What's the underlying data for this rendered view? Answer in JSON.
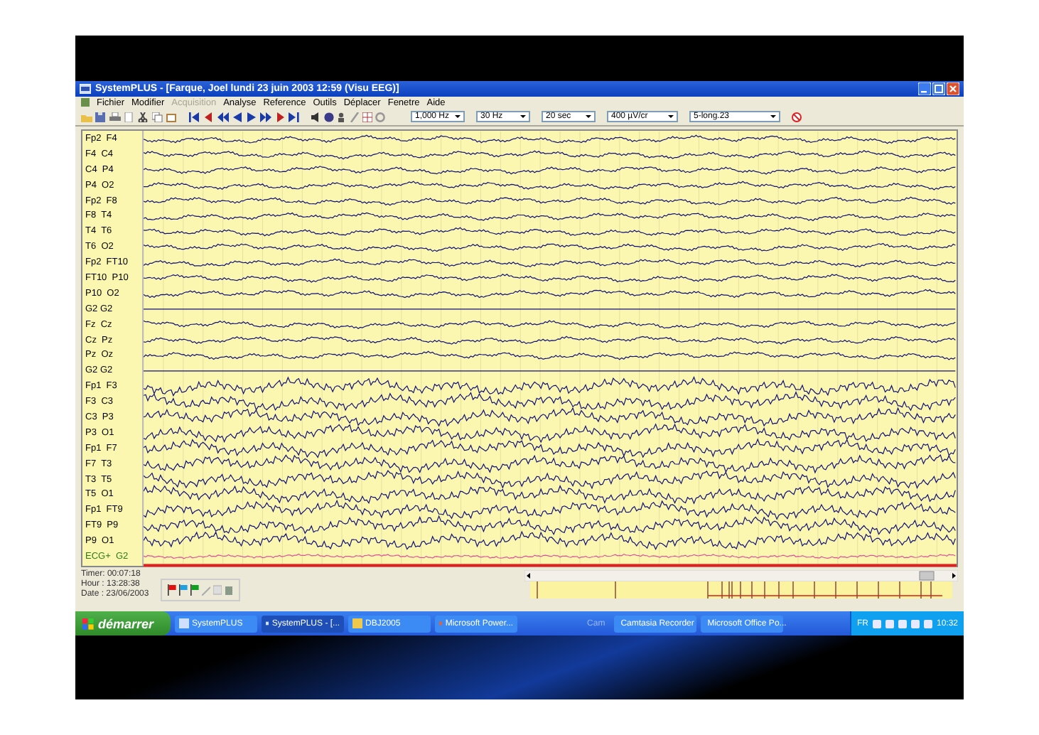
{
  "window": {
    "title": "SystemPLUS - [Farque, Joel lundi 23 juin 2003 12:59 (Visu EEG)]"
  },
  "menu": [
    {
      "label": "Fichier",
      "disabled": false
    },
    {
      "label": "Modifier",
      "disabled": false
    },
    {
      "label": "Acquisition",
      "disabled": true
    },
    {
      "label": "Analyse",
      "disabled": false
    },
    {
      "label": "Reference",
      "disabled": false
    },
    {
      "label": "Outils",
      "disabled": false
    },
    {
      "label": "Déplacer",
      "disabled": false
    },
    {
      "label": "Fenetre",
      "disabled": false
    },
    {
      "label": "Aide",
      "disabled": false
    }
  ],
  "toolbar": {
    "dropdowns": [
      "1,000 Hz",
      "30 Hz",
      "20 sec",
      "400 µV/cr",
      "5-long.23"
    ]
  },
  "channels": [
    {
      "label": "Fp2  F4",
      "kind": "eeg"
    },
    {
      "label": "F4  C4",
      "kind": "eeg"
    },
    {
      "label": "C4  P4",
      "kind": "eeg"
    },
    {
      "label": "P4  O2",
      "kind": "eeg"
    },
    {
      "label": "Fp2  F8",
      "kind": "eeg"
    },
    {
      "label": "F8  T4",
      "kind": "eeg"
    },
    {
      "label": "T4  T6",
      "kind": "eeg"
    },
    {
      "label": "T6  O2",
      "kind": "eeg"
    },
    {
      "label": "Fp2  FT10",
      "kind": "eeg"
    },
    {
      "label": "FT10  P10",
      "kind": "eeg"
    },
    {
      "label": "P10  O2",
      "kind": "eeg"
    },
    {
      "label": "G2 G2",
      "kind": "eeg"
    },
    {
      "label": "Fz  Cz",
      "kind": "eeg"
    },
    {
      "label": "Cz  Pz",
      "kind": "eeg"
    },
    {
      "label": "Pz  Oz",
      "kind": "eeg"
    },
    {
      "label": "G2 G2",
      "kind": "eeg"
    },
    {
      "label": "Fp1  F3",
      "kind": "eeg"
    },
    {
      "label": "F3  C3",
      "kind": "eeg"
    },
    {
      "label": "C3  P3",
      "kind": "eeg"
    },
    {
      "label": "P3  O1",
      "kind": "eeg"
    },
    {
      "label": "Fp1  F7",
      "kind": "eeg"
    },
    {
      "label": "F7  T3",
      "kind": "eeg"
    },
    {
      "label": "T3  T5",
      "kind": "eeg"
    },
    {
      "label": "T5  O1",
      "kind": "eeg"
    },
    {
      "label": "Fp1  FT9",
      "kind": "eeg"
    },
    {
      "label": "FT9  P9",
      "kind": "eeg"
    },
    {
      "label": "P9  O1",
      "kind": "eeg"
    },
    {
      "label": "ECG+  G2",
      "kind": "ecg"
    }
  ],
  "status": [
    {
      "label": "Timer:",
      "value": "00:07:18"
    },
    {
      "label": "Hour :",
      "value": "13:28:38"
    },
    {
      "label": "Date :",
      "value": "23/06/2003"
    }
  ],
  "taskbar": {
    "start": "démarrer",
    "items": [
      {
        "label": "SystemPLUS",
        "selected": false
      },
      {
        "label": "SystemPLUS - [...",
        "selected": true
      },
      {
        "label": "DBJ2005",
        "selected": false
      },
      {
        "label": "Microsoft Power...",
        "selected": false
      },
      {
        "label": "Cam",
        "selected": false
      },
      {
        "label": "Camtasia Recorder",
        "selected": false
      },
      {
        "label": "Microsoft Office Po...",
        "selected": false
      }
    ],
    "language": "FR",
    "clock": "10:32"
  }
}
